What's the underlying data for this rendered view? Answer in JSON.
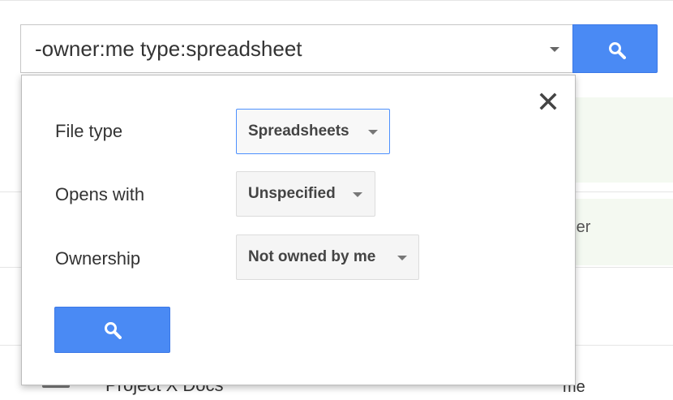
{
  "search": {
    "query": "-owner:me type:spreadsheet"
  },
  "background": {
    "column_header_owner": "wner",
    "rows": [
      {
        "owner": "e"
      },
      {
        "name": "Project X Docs",
        "owner": "me"
      }
    ]
  },
  "panel": {
    "rows": [
      {
        "label": "File type",
        "value": "Spreadsheets"
      },
      {
        "label": "Opens with",
        "value": "Unspecified"
      },
      {
        "label": "Ownership",
        "value": "Not owned by me"
      }
    ]
  },
  "icons": {
    "search": "search-icon",
    "close": "close-icon",
    "dropdown": "chevron-down-icon",
    "options": "caret-down-icon",
    "file": "folder-icon"
  },
  "colors": {
    "accent_blue": "#4a8af4",
    "focus_border": "#4d90fe",
    "light_green": "#f4f9f1"
  }
}
